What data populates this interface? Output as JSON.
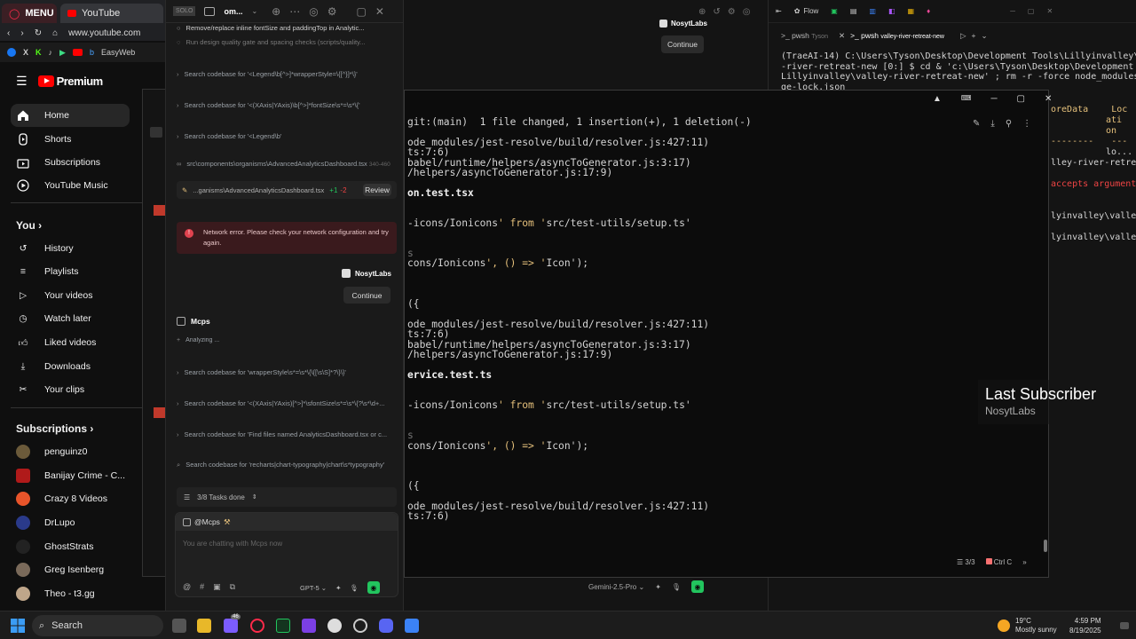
{
  "browser": {
    "tab_menu": "MENU",
    "tab_youtube": "YouTube",
    "address": "www.youtube.com",
    "bookmark": "EasyWeb",
    "logo_text": "Premium",
    "nav": [
      {
        "label": "Home"
      },
      {
        "label": "Shorts"
      },
      {
        "label": "Subscriptions"
      },
      {
        "label": "YouTube Music"
      }
    ],
    "you_title": "You",
    "you_items": [
      {
        "label": "History"
      },
      {
        "label": "Playlists"
      },
      {
        "label": "Your videos"
      },
      {
        "label": "Watch later"
      },
      {
        "label": "Liked videos"
      },
      {
        "label": "Downloads"
      },
      {
        "label": "Your clips"
      }
    ],
    "subs_title": "Subscriptions",
    "subs": [
      {
        "label": "penguinz0"
      },
      {
        "label": "Banijay Crime - C..."
      },
      {
        "label": "Crazy 8 Videos"
      },
      {
        "label": "DrLupo"
      },
      {
        "label": "GhostStrats"
      },
      {
        "label": "Greg Isenberg"
      },
      {
        "label": "Theo - t3.gg"
      }
    ]
  },
  "chat": {
    "window_title": "om...",
    "task1": "Remove/replace inline fontSize and paddingTop in Analytic...",
    "task2": "Run design quality gate and spacing checks (scripts/quality...",
    "searches_top": [
      "Search codebase for '<Legend\\b[^>]*wrapperStyle=\\{[^}]*\\}'",
      "Search codebase for '<(XAxis|YAxis)\\b[^>]*fontSize\\s*=\\s*\\{'",
      "Search codebase for '<Legend\\b'"
    ],
    "file_path": "src\\components\\organisms\\AdvancedAnalyticsDashboard.tsx",
    "file_lines": "340-460",
    "edit_file": "...ganisms\\AdvancedAnalyticsDashboard.tsx",
    "edit_add": "+1",
    "edit_del": "-2",
    "review_label": "Review",
    "error_text": "Network error. Please check your network configuration and try again.",
    "brand": "NosytLabs",
    "continue_label": "Continue",
    "mcps_label": "Mcps",
    "analyzing": "Analyzing ...",
    "searches_bottom": [
      "Search codebase for 'wrapperStyle\\s*=\\s*\\{\\{[\\s\\S]*?\\}\\}'",
      "Search codebase for '<(XAxis|YAxis)[^>]*\\sfontSize\\s*=\\s*\\{?\\s*\\d+...",
      "Search codebase for 'Find files named AnalyticsDashboard.tsx or c...",
      "Search codebase for 'recharts|chart-typography|chart\\s*typography'"
    ],
    "tasks_done": "3/8 Tasks done",
    "mention": "@Mcps",
    "input_placeholder": "You are chatting with Mcps now",
    "model": "GPT-5"
  },
  "topmid": {
    "brand": "NosytLabs",
    "continue_label": "Continue",
    "model": "Gemini-2.5-Pro"
  },
  "terminal": {
    "lines": [
      {
        "t": "git:(main)  1 file changed, 1 insertion(+), 1 deletion(-)",
        "c": ""
      },
      {
        "t": "",
        "c": ""
      },
      {
        "t": "ode_modules/jest-resolve/build/resolver.js:427:11)",
        "c": ""
      },
      {
        "t": "ts:7:6)",
        "c": ""
      },
      {
        "t": "babel/runtime/helpers/asyncToGenerator.js:3:17)",
        "c": ""
      },
      {
        "t": "/helpers/asyncToGenerator.js:17:9)",
        "c": ""
      },
      {
        "t": "",
        "c": ""
      },
      {
        "t": "on.test.tsx",
        "c": "b"
      },
      {
        "t": "",
        "c": ""
      },
      {
        "t": "",
        "c": ""
      },
      {
        "t": "-icons/Ionicons' from 'src/test-utils/setup.ts'",
        "c": "y"
      },
      {
        "t": "",
        "c": ""
      },
      {
        "t": "",
        "c": ""
      },
      {
        "t": "s",
        "c": "d"
      },
      {
        "t": "cons/Ionicons', () => 'Icon');",
        "c": "y"
      },
      {
        "t": "",
        "c": ""
      },
      {
        "t": "",
        "c": ""
      },
      {
        "t": "",
        "c": ""
      },
      {
        "t": "({",
        "c": ""
      },
      {
        "t": "",
        "c": ""
      },
      {
        "t": "ode_modules/jest-resolve/build/resolver.js:427:11)",
        "c": ""
      },
      {
        "t": "ts:7:6)",
        "c": ""
      },
      {
        "t": "babel/runtime/helpers/asyncToGenerator.js:3:17)",
        "c": ""
      },
      {
        "t": "/helpers/asyncToGenerator.js:17:9)",
        "c": ""
      },
      {
        "t": "",
        "c": ""
      },
      {
        "t": "ervice.test.ts",
        "c": "b"
      },
      {
        "t": "",
        "c": ""
      },
      {
        "t": "",
        "c": ""
      },
      {
        "t": "-icons/Ionicons' from 'src/test-utils/setup.ts'",
        "c": "y"
      },
      {
        "t": "",
        "c": ""
      },
      {
        "t": "",
        "c": ""
      },
      {
        "t": "s",
        "c": "d"
      },
      {
        "t": "cons/Ionicons', () => 'Icon');",
        "c": "y"
      },
      {
        "t": "",
        "c": ""
      },
      {
        "t": "",
        "c": ""
      },
      {
        "t": "",
        "c": ""
      },
      {
        "t": "({",
        "c": ""
      },
      {
        "t": "",
        "c": ""
      },
      {
        "t": "ode_modules/jest-resolve/build/resolver.js:427:11)",
        "c": ""
      },
      {
        "t": "ts:7:6)",
        "c": ""
      }
    ],
    "find_count": "3/3",
    "interrupt": "Ctrl C"
  },
  "editor": {
    "tab_flow": "Flow",
    "term_tab1": "pwsh",
    "term_tab1_sub": "Tyson",
    "term_tab2": "pwsh",
    "term_tab2_sub": "valley-river-retreat-new",
    "text": "(TraeAI-14) C:\\Users\\Tyson\\Desktop\\Development Tools\\Lillyinvalley\\valley\n-river-retreat-new [0:] $ cd & 'c:\\Users\\Tyson\\Desktop\\Development Tools\\\nLillyinvalley\\valley-river-retreat-new' ; rm -r -force node_modules packa\nge-lock.json",
    "side_lines": [
      "oreData",
      "Loc",
      "ati",
      "on",
      "--------",
      "---",
      "lo...",
      "lley-river-retre",
      "accepts argument",
      "lyinvalley\\valley",
      "lyinvalley\\valley"
    ]
  },
  "overlay": {
    "title": "Last Subscriber",
    "name": "NosytLabs"
  },
  "taskbar": {
    "search": "Search",
    "badge": "46",
    "temp": "19°C",
    "weather": "Mostly sunny",
    "time": "4:59 PM",
    "date": "8/19/2025"
  },
  "colors": {
    "yt_red": "#ff0000",
    "error_bg": "#3a1a1d",
    "accent_green": "#22c55e",
    "string_yellow": "#e5c07b"
  }
}
